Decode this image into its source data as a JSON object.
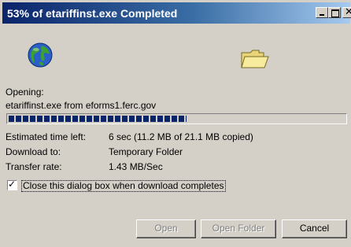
{
  "window": {
    "title": "53% of etariffinst.exe Completed"
  },
  "icons": {
    "globe": "globe-icon",
    "folder": "folder-icon"
  },
  "opening": {
    "label": "Opening:",
    "value": "etariffinst.exe from eforms1.ferc.gov"
  },
  "progress": {
    "percent": 53
  },
  "info": {
    "time_label": "Estimated time left:",
    "time_value": "6 sec (11.2 MB of 21.1 MB copied)",
    "dl_label": "Download to:",
    "dl_value": "Temporary Folder",
    "rate_label": "Transfer rate:",
    "rate_value": "1.43 MB/Sec"
  },
  "checkbox": {
    "checked": true,
    "label": "Close this dialog box when download completes"
  },
  "buttons": {
    "open": "Open",
    "open_folder": "Open Folder",
    "cancel": "Cancel"
  },
  "colors": {
    "title_start": "#0a246a",
    "title_end": "#a6caf0",
    "progress": "#0a246a",
    "face": "#d4d0c8"
  }
}
